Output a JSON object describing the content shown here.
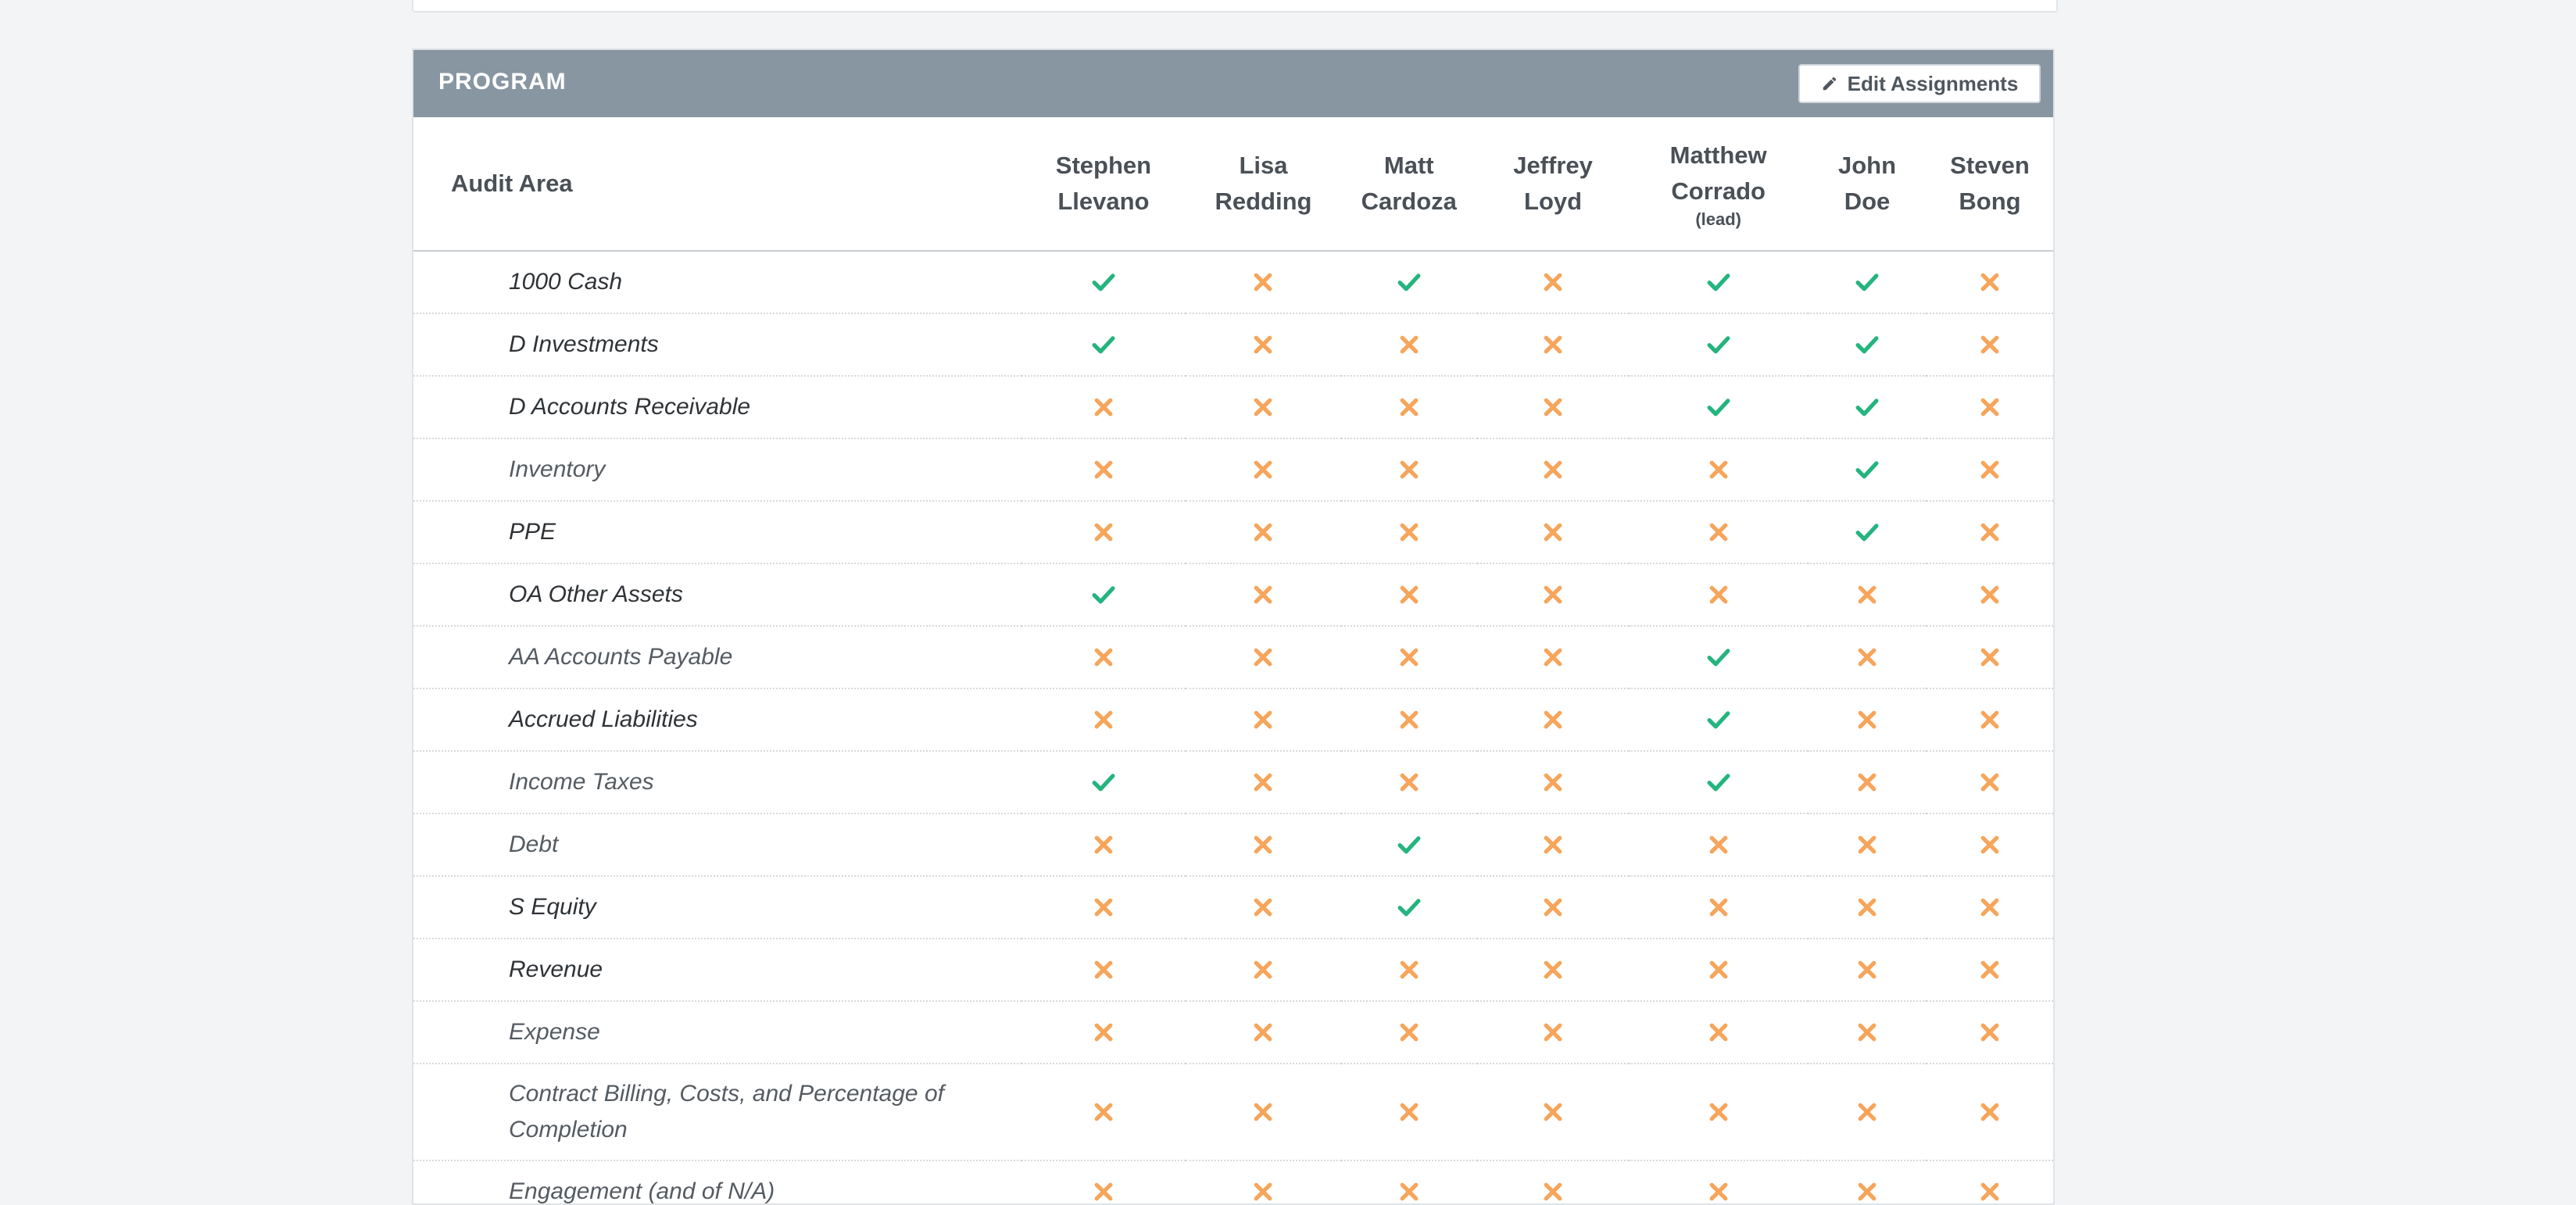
{
  "section": {
    "title": "PROGRAM",
    "edit_label": "Edit Assignments"
  },
  "colors": {
    "yes": "#24b47e",
    "no": "#f6a55b",
    "header_bg": "#8896a2"
  },
  "table": {
    "area_header": "Audit Area",
    "people": [
      {
        "first": "Stephen",
        "last": "Llevano",
        "note": ""
      },
      {
        "first": "Lisa",
        "last": "Redding",
        "note": ""
      },
      {
        "first": "Matt",
        "last": "Cardoza",
        "note": ""
      },
      {
        "first": "Jeffrey",
        "last": "Loyd",
        "note": ""
      },
      {
        "first": "Matthew",
        "last": "Corrado",
        "note": "(lead)"
      },
      {
        "first": "John",
        "last": "Doe",
        "note": ""
      },
      {
        "first": "Steven",
        "last": "Bong",
        "note": ""
      }
    ],
    "rows": [
      {
        "area": "1000 Cash",
        "dim": false,
        "marks": [
          true,
          false,
          true,
          false,
          true,
          true,
          false
        ]
      },
      {
        "area": "D Investments",
        "dim": false,
        "marks": [
          true,
          false,
          false,
          false,
          true,
          true,
          false
        ]
      },
      {
        "area": "D Accounts Receivable",
        "dim": false,
        "marks": [
          false,
          false,
          false,
          false,
          true,
          true,
          false
        ]
      },
      {
        "area": "Inventory",
        "dim": true,
        "marks": [
          false,
          false,
          false,
          false,
          false,
          true,
          false
        ]
      },
      {
        "area": "PPE",
        "dim": false,
        "marks": [
          false,
          false,
          false,
          false,
          false,
          true,
          false
        ]
      },
      {
        "area": "OA Other Assets",
        "dim": false,
        "marks": [
          true,
          false,
          false,
          false,
          false,
          false,
          false
        ]
      },
      {
        "area": "AA Accounts Payable",
        "dim": true,
        "marks": [
          false,
          false,
          false,
          false,
          true,
          false,
          false
        ]
      },
      {
        "area": "Accrued Liabilities",
        "dim": false,
        "marks": [
          false,
          false,
          false,
          false,
          true,
          false,
          false
        ]
      },
      {
        "area": "Income Taxes",
        "dim": true,
        "marks": [
          true,
          false,
          false,
          false,
          true,
          false,
          false
        ]
      },
      {
        "area": "Debt",
        "dim": true,
        "marks": [
          false,
          false,
          true,
          false,
          false,
          false,
          false
        ]
      },
      {
        "area": "S Equity",
        "dim": false,
        "marks": [
          false,
          false,
          true,
          false,
          false,
          false,
          false
        ]
      },
      {
        "area": "Revenue",
        "dim": false,
        "marks": [
          false,
          false,
          false,
          false,
          false,
          false,
          false
        ]
      },
      {
        "area": "Expense",
        "dim": true,
        "marks": [
          false,
          false,
          false,
          false,
          false,
          false,
          false
        ]
      },
      {
        "area": "Contract Billing, Costs, and Percentage of Completion",
        "dim": true,
        "tall": true,
        "marks": [
          false,
          false,
          false,
          false,
          false,
          false,
          false
        ]
      },
      {
        "area": "Engagement (and of N/A)",
        "dim": true,
        "marks": [
          false,
          false,
          false,
          false,
          false,
          false,
          false
        ]
      }
    ]
  }
}
